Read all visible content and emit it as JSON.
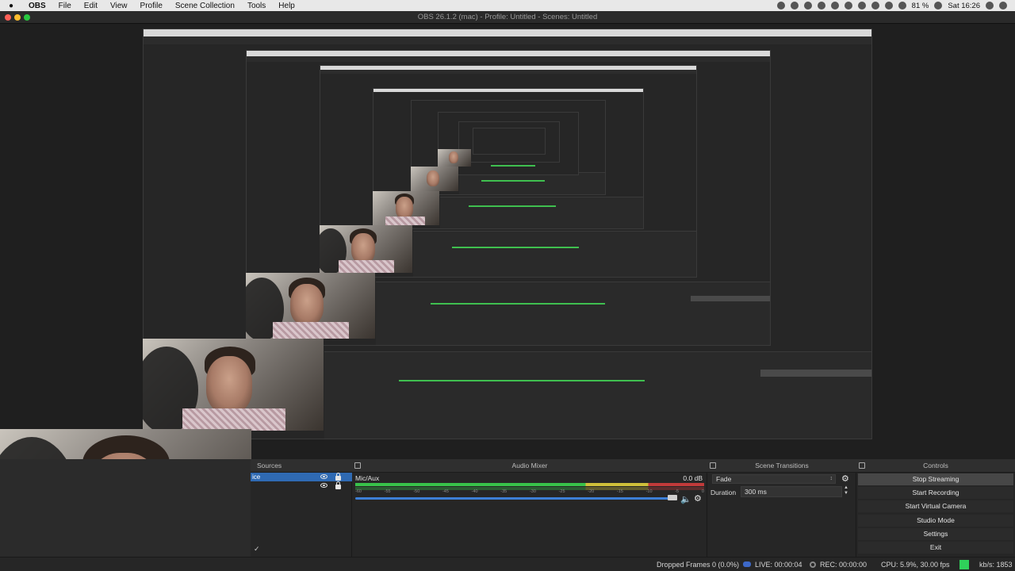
{
  "menubar": {
    "app_name": "OBS",
    "items": [
      "File",
      "Edit",
      "View",
      "Profile",
      "Scene Collection",
      "Tools",
      "Help"
    ],
    "battery": "81 %",
    "clock": "Sat 16:26"
  },
  "window": {
    "title": "OBS 26.1.2 (mac) - Profile: Untitled - Scenes: Untitled"
  },
  "docks": {
    "sources": {
      "title": "Sources",
      "items": [
        {
          "name": "ice",
          "selected": true
        },
        {
          "name": "",
          "selected": false
        }
      ]
    },
    "mixer": {
      "title": "Audio Mixer",
      "channel_name": "Mic/Aux",
      "level": "0.0 dB",
      "scale": [
        "-60",
        "-55",
        "-50",
        "-45",
        "-40",
        "-35",
        "-30",
        "-25",
        "-20",
        "-15",
        "-10",
        "-5",
        "0"
      ]
    },
    "transitions": {
      "title": "Scene Transitions",
      "selected": "Fade",
      "duration_label": "Duration",
      "duration_value": "300 ms"
    },
    "controls": {
      "title": "Controls",
      "buttons": [
        "Stop Streaming",
        "Start Recording",
        "Start Virtual Camera",
        "Studio Mode",
        "Settings",
        "Exit"
      ],
      "active_index": 0
    }
  },
  "statusbar": {
    "dropped": "Dropped Frames 0 (0.0%)",
    "live": "LIVE: 00:00:04",
    "rec": "REC: 00:00:00",
    "cpu": "CPU: 5.9%, 30.00 fps",
    "kbs": "kb/s: 1853"
  },
  "colors": {
    "accent_blue": "#2f6ab3",
    "meter_green": "#38c24a",
    "status_green": "#2fd05a"
  }
}
